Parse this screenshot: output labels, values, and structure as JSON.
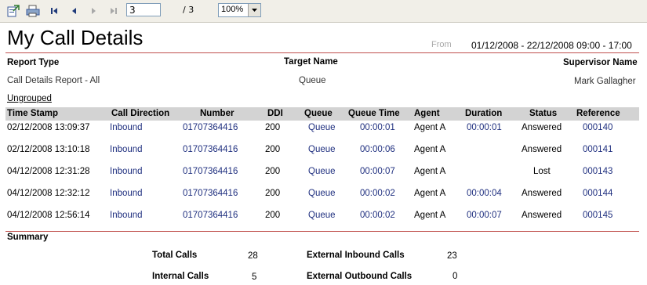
{
  "toolbar": {
    "export_icon": "export-icon",
    "print_icon": "print-icon",
    "first_icon": "first-page-icon",
    "prev_icon": "previous-page-icon",
    "next_icon": "next-page-icon",
    "last_icon": "last-page-icon",
    "page_value": "3",
    "page_total": "/ 3",
    "zoom_value": "100%"
  },
  "report": {
    "title": "My Call Details",
    "from_label": "From",
    "date_range": "01/12/2008 - 22/12/2008  09:00 - 17:00",
    "report_type_label": "Report Type",
    "report_type_value": "Call Details Report - All",
    "target_name_label": "Target Name",
    "target_name_value": "Queue",
    "supervisor_label": "Supervisor Name",
    "supervisor_value": "Mark Gallagher",
    "grouping_link": "Ungrouped",
    "accent_color": "#c0504d"
  },
  "table": {
    "headers": [
      "Time Stamp",
      "Call Direction",
      "Number",
      "DDI",
      "Queue",
      "Queue Time",
      "Agent",
      "Duration",
      "Status",
      "Reference"
    ],
    "rows": [
      [
        "02/12/2008 13:09:37",
        "Inbound",
        "01707364416",
        "200",
        "Queue",
        "00:00:01",
        "Agent A",
        "00:00:01",
        "Answered",
        "000140"
      ],
      [
        "02/12/2008 13:10:18",
        "Inbound",
        "01707364416",
        "200",
        "Queue",
        "00:00:06",
        "Agent A",
        "",
        "Answered",
        "000141"
      ],
      [
        "04/12/2008 12:31:28",
        "Inbound",
        "01707364416",
        "200",
        "Queue",
        "00:00:07",
        "Agent A",
        "",
        "Lost",
        "000143"
      ],
      [
        "04/12/2008 12:32:12",
        "Inbound",
        "01707364416",
        "200",
        "Queue",
        "00:00:02",
        "Agent A",
        "00:00:04",
        "Answered",
        "000144"
      ],
      [
        "04/12/2008 12:56:14",
        "Inbound",
        "01707364416",
        "200",
        "Queue",
        "00:00:02",
        "Agent A",
        "00:00:07",
        "Answered",
        "000145"
      ]
    ]
  },
  "summary": {
    "heading": "Summary",
    "total_calls_label": "Total Calls",
    "total_calls_value": "28",
    "internal_calls_label": "Internal Calls",
    "internal_calls_value": "5",
    "external_inbound_label": "External Inbound Calls",
    "external_inbound_value": "23",
    "external_outbound_label": "External Outbound Calls",
    "external_outbound_value": "0"
  }
}
